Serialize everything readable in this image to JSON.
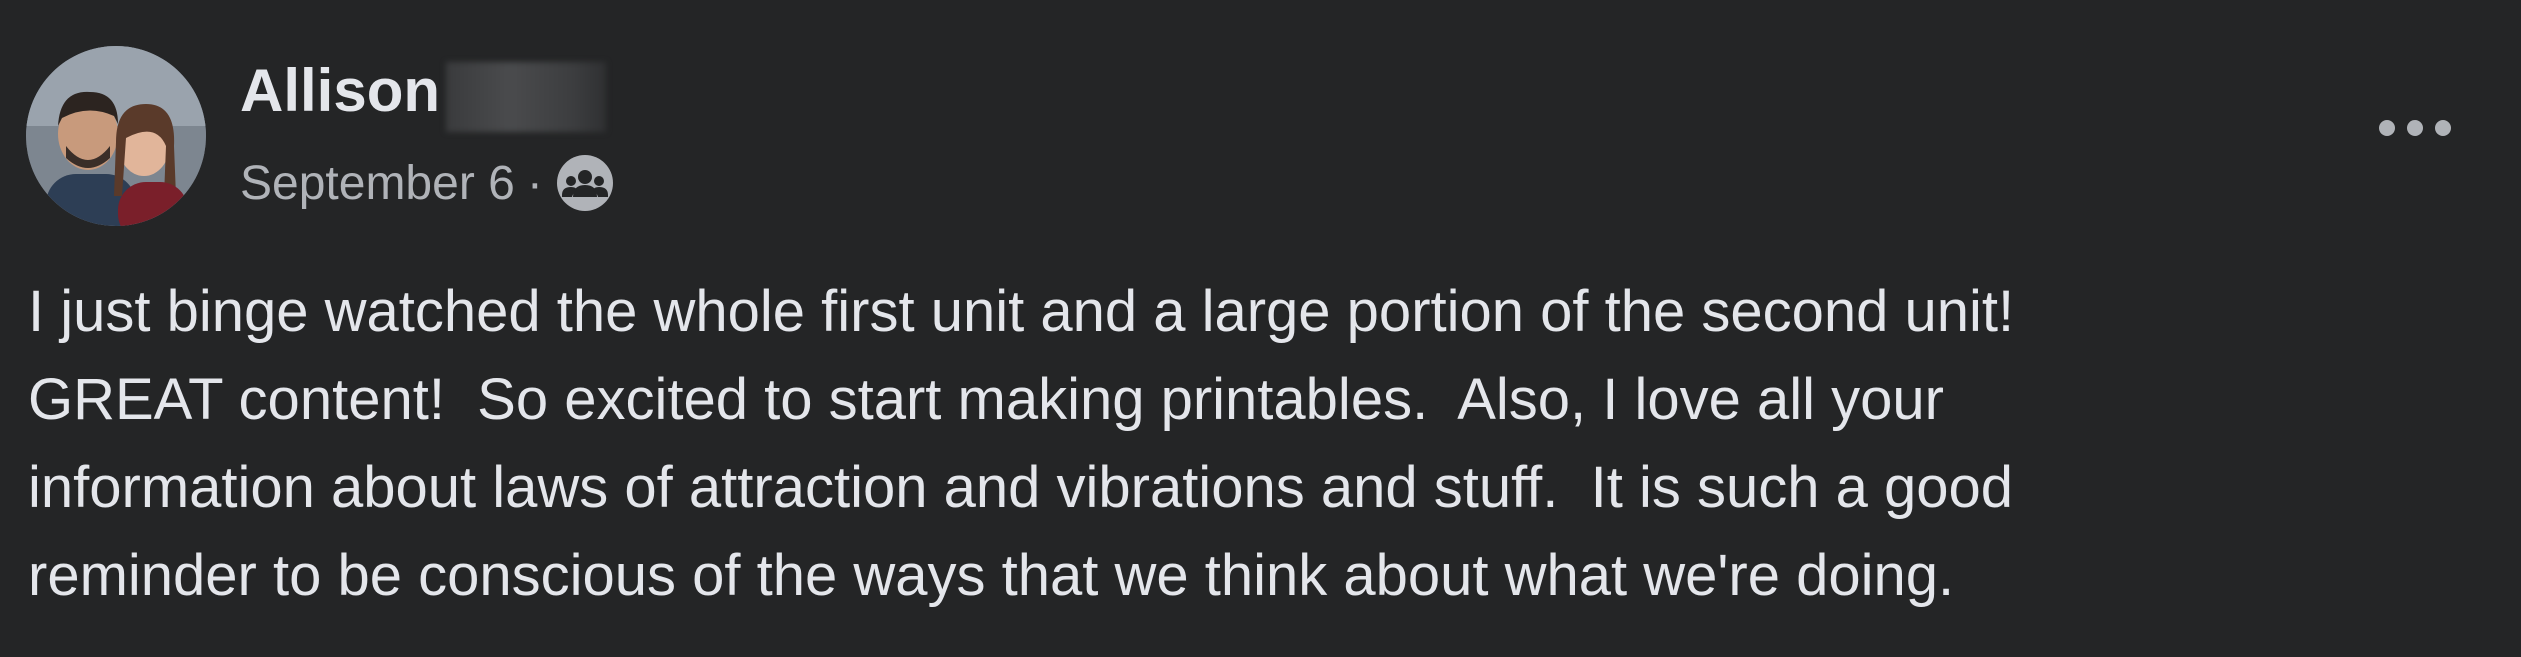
{
  "post": {
    "author": {
      "name": "Allison",
      "avatar_icon": "profile-photo-couple"
    },
    "date": "September 6",
    "separator": "·",
    "audience_icon": "group-audience-icon",
    "more_icon": "more-options-icon",
    "body": "I just binge watched the whole first unit and a large portion of the second unit!\nGREAT content!  So excited to start making printables.  Also, I love all your\ninformation about laws of attraction and vibrations and stuff.  It is such a good\nreminder to be conscious of the ways that we think about what we're doing."
  },
  "colors": {
    "background": "#242526",
    "primary_text": "#e4e6eb",
    "secondary_text": "#b0b3b8"
  }
}
